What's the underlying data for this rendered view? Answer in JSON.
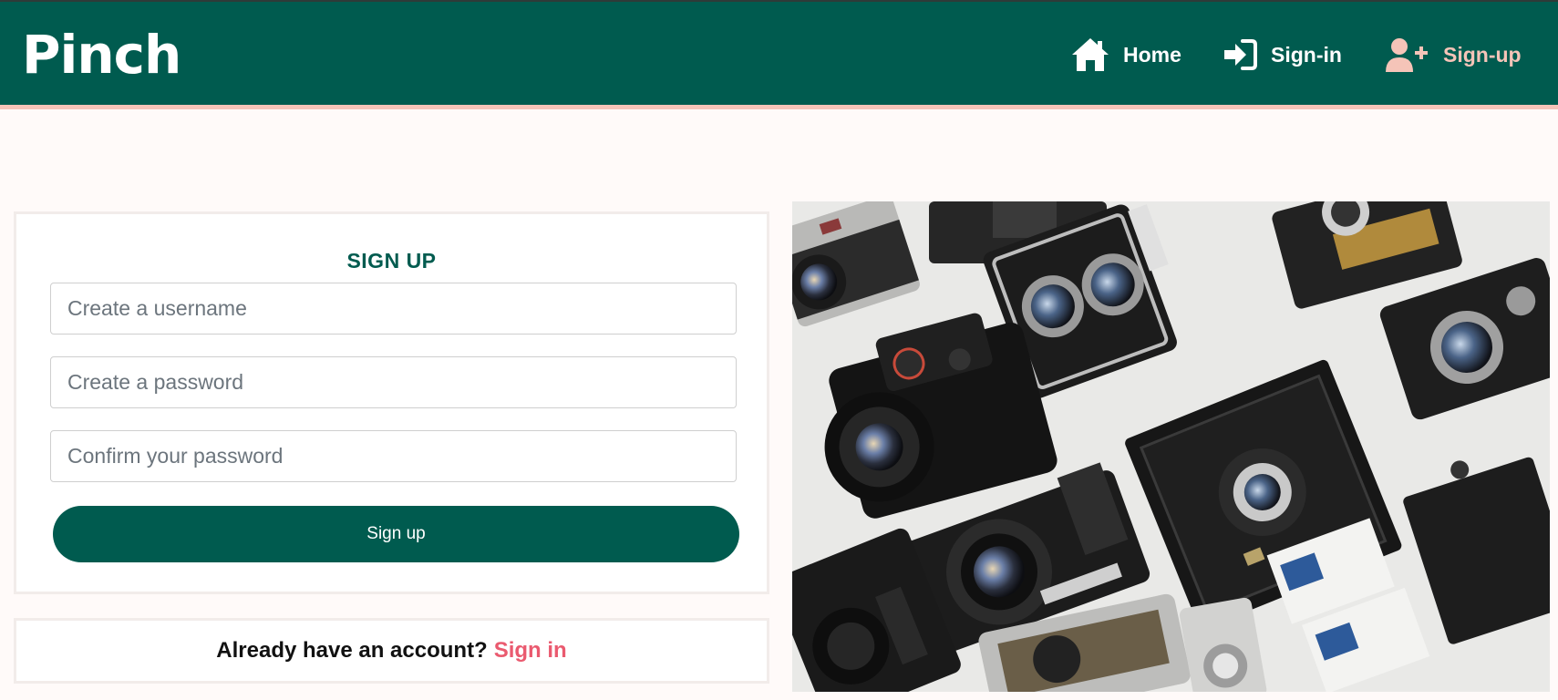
{
  "navbar": {
    "brand": "Pinch",
    "links": [
      {
        "label": "Home",
        "icon": "home-icon"
      },
      {
        "label": "Sign-in",
        "icon": "sign-in-icon"
      },
      {
        "label": "Sign-up",
        "icon": "user-plus-icon",
        "active": true
      }
    ]
  },
  "signup_form": {
    "title": "SIGN UP",
    "username_placeholder": "Create a username",
    "password_placeholder": "Create a password",
    "confirm_placeholder": "Confirm your password",
    "submit_label": "Sign up"
  },
  "signin_prompt": {
    "text": "Already have an account?",
    "link_label": "Sign in"
  },
  "hero_image": {
    "description_icon": "vintage-cameras-photo"
  },
  "colors": {
    "brand_green": "#005b4f",
    "accent_pink": "#ea5a6f",
    "nav_active": "#f5c4b8",
    "page_bg": "#fffaf9"
  }
}
